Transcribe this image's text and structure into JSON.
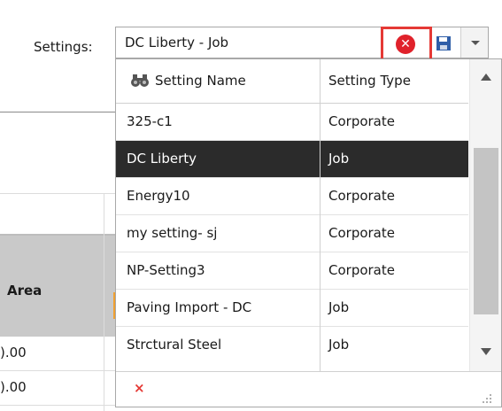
{
  "settings": {
    "label": "Settings:",
    "value": "DC Liberty - Job",
    "clear_icon": "clear-circle-x-icon",
    "save_icon": "save-disk-icon",
    "dropdown_icon": "chevron-down-icon"
  },
  "popup": {
    "columns": [
      "Setting Name",
      "Setting Type"
    ],
    "rows": [
      {
        "name": "325-c1",
        "type": "Corporate"
      },
      {
        "name": "DC Liberty",
        "type": "Job"
      },
      {
        "name": "Energy10",
        "type": "Corporate"
      },
      {
        "name": "my setting- sj",
        "type": "Corporate"
      },
      {
        "name": "NP-Setting3",
        "type": "Corporate"
      },
      {
        "name": "Paving Import - DC",
        "type": "Job"
      },
      {
        "name": "Strctural Steel",
        "type": "Job"
      }
    ],
    "footer_clear": "×",
    "search_icon": "binoculars-icon"
  },
  "background_grid": {
    "column_header": "Area",
    "cells": [
      ").00",
      ").00"
    ]
  },
  "colors": {
    "selection": "#2b2b2b",
    "highlight_border": "#e53935",
    "clear_icon": "#e0222b",
    "save_icon": "#2f5ea8"
  }
}
